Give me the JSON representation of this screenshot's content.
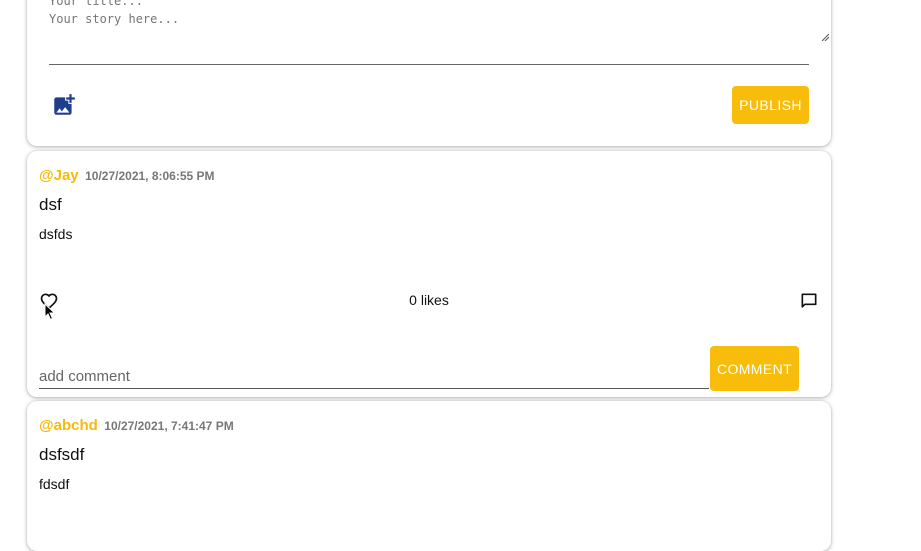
{
  "composer": {
    "title_placeholder": "Your title...",
    "story_placeholder": "Your story here...",
    "publish_label": "PUBLISH",
    "add_photo_icon": "add-photo-icon"
  },
  "posts": [
    {
      "author": "@Jay",
      "timestamp": "10/27/2021, 8:06:55 PM",
      "title": "dsf",
      "body": "dsfds",
      "likes": "0 likes",
      "comment_placeholder": "add comment",
      "comment_label": "COMMENT"
    },
    {
      "author": "@abchd",
      "timestamp": "10/27/2021, 7:41:47 PM",
      "title": "dsfsdf",
      "body": "fdsdf"
    }
  ],
  "colors": {
    "accent": "#f7bd0a",
    "author": "#f7b90a",
    "icon_blue": "#1f3e8c"
  }
}
